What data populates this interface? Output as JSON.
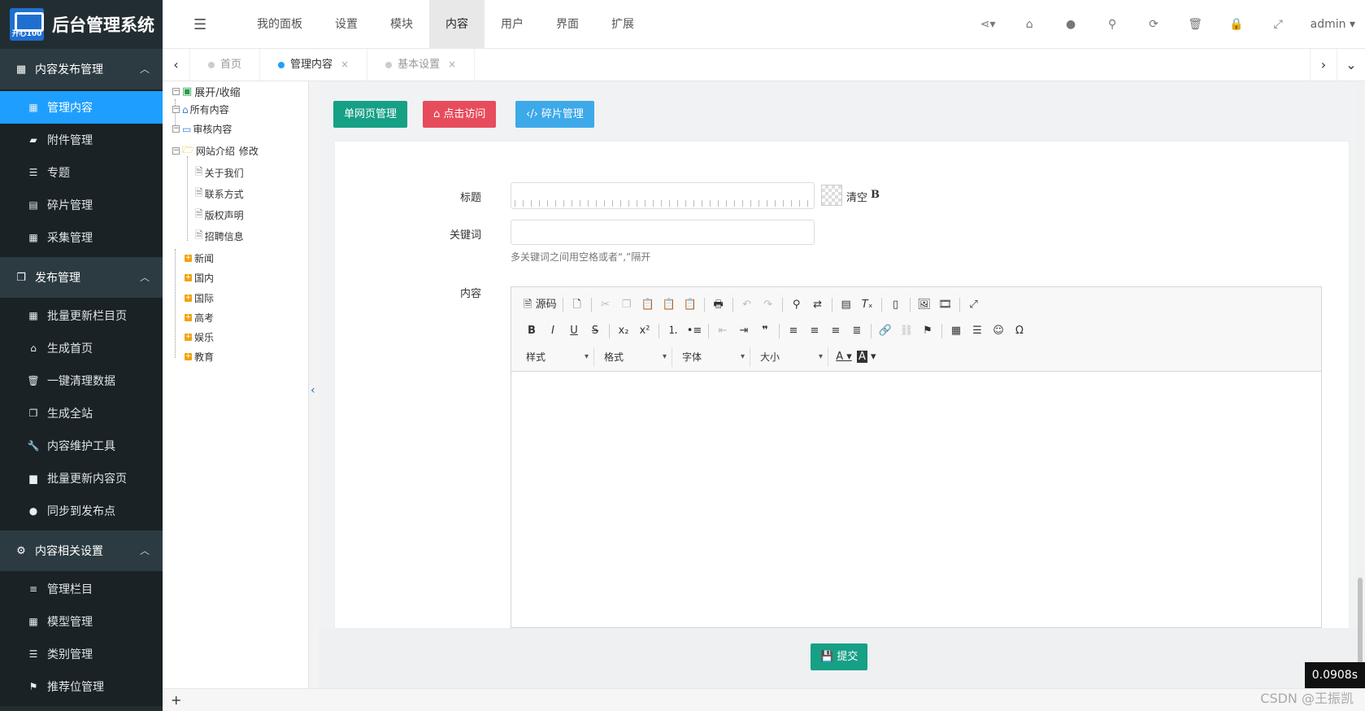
{
  "app": {
    "title": "后台管理系统",
    "logo_text": "开心100"
  },
  "sidebar": {
    "groups": [
      {
        "label": "内容发布管理",
        "icon": "grid-icon",
        "items": [
          {
            "label": "管理内容",
            "icon": "grid-icon",
            "active": true
          },
          {
            "label": "附件管理",
            "icon": "folder-icon"
          },
          {
            "label": "专题",
            "icon": "list-icon"
          },
          {
            "label": "碎片管理",
            "icon": "table-icon"
          },
          {
            "label": "采集管理",
            "icon": "grid-icon"
          }
        ]
      },
      {
        "label": "发布管理",
        "icon": "copy-icon",
        "items": [
          {
            "label": "批量更新栏目页",
            "icon": "grid-icon"
          },
          {
            "label": "生成首页",
            "icon": "home-icon"
          },
          {
            "label": "一键清理数据",
            "icon": "trash-icon"
          },
          {
            "label": "生成全站",
            "icon": "copy-icon"
          },
          {
            "label": "内容维护工具",
            "icon": "wrench-icon"
          },
          {
            "label": "批量更新内容页",
            "icon": "doc-icon"
          },
          {
            "label": "同步到发布点",
            "icon": "globe-icon"
          }
        ]
      },
      {
        "label": "内容相关设置",
        "icon": "cogs-icon",
        "items": [
          {
            "label": "管理栏目",
            "icon": "bars-icon"
          },
          {
            "label": "模型管理",
            "icon": "grid-icon"
          },
          {
            "label": "类别管理",
            "icon": "list-icon"
          },
          {
            "label": "推荐位管理",
            "icon": "flag-icon"
          }
        ]
      }
    ]
  },
  "topnav": {
    "items": [
      "我的面板",
      "设置",
      "模块",
      "内容",
      "用户",
      "界面",
      "扩展"
    ],
    "active": "内容",
    "tools": [
      "share-icon",
      "home-icon",
      "user-icon",
      "search-icon",
      "refresh-icon",
      "trash-icon",
      "lock-icon",
      "fullscreen-icon"
    ],
    "user": "admin"
  },
  "tabs": [
    {
      "label": "首页",
      "closable": false
    },
    {
      "label": "管理内容",
      "closable": true,
      "active": true
    },
    {
      "label": "基本设置",
      "closable": true
    }
  ],
  "tree": {
    "root": "展开/收缩",
    "nodes": [
      "所有内容",
      "审核内容",
      "网站介绍"
    ],
    "edit_link": "修改",
    "children": [
      "关于我们",
      "联系方式",
      "版权声明",
      "招聘信息"
    ],
    "categories": [
      "新闻",
      "国内",
      "国际",
      "高考",
      "娱乐",
      "教育"
    ]
  },
  "actions": {
    "single_page": "单网页管理",
    "visit": "点击访问",
    "fragment": "碎片管理"
  },
  "form": {
    "title_label": "标题",
    "title_value": "",
    "clear_label": "清空",
    "bold_label": "B",
    "keywords_label": "关键词",
    "keywords_value": "",
    "keywords_help": "多关键词之间用空格或者“,”隔开",
    "content_label": "内容",
    "submit": "提交"
  },
  "editor": {
    "source": "源码",
    "combos": [
      "样式",
      "格式",
      "字体",
      "大小"
    ]
  },
  "timer": "0.0908s",
  "watermark": "CSDN @王振凯"
}
